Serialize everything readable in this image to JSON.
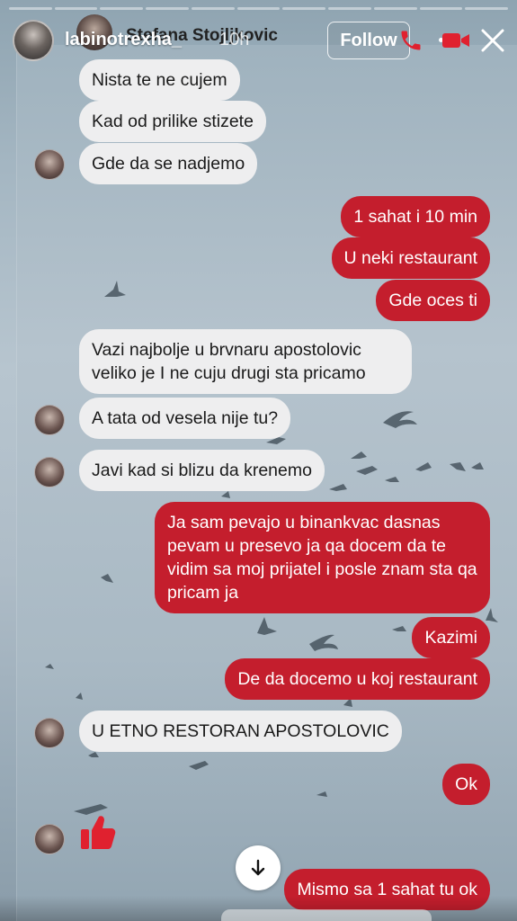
{
  "story": {
    "username": "labinotrexha_",
    "time_ago": "10h",
    "follow_label": "Follow",
    "progress_segments": 11
  },
  "chat": {
    "contact_name": "Stefana Stojljkovic",
    "messages": [
      {
        "dir": "in",
        "text": "Nista te ne cujem"
      },
      {
        "dir": "in",
        "text": "Kad od prilike stizete"
      },
      {
        "dir": "in",
        "text": "Gde da se nadjemo"
      },
      {
        "dir": "out",
        "text": "1 sahat i 10 min"
      },
      {
        "dir": "out",
        "text": "U neki restaurant"
      },
      {
        "dir": "out",
        "text": "Gde oces ti"
      },
      {
        "dir": "in",
        "text": "Vazi najbolje u brvnaru apostolovic veliko je I ne cuju drugi sta pricamo"
      },
      {
        "dir": "in",
        "text": "A tata od vesela nije tu?"
      },
      {
        "dir": "in",
        "text": "Javi kad si blizu da krenemo"
      },
      {
        "dir": "out",
        "text": "Ja sam pevajo u binankvac dasnas pevam u presevo ja qa docem da te vidim sa moj prijatel i posle znam sta qa pricam ja"
      },
      {
        "dir": "out",
        "text": "Kazimi"
      },
      {
        "dir": "out",
        "text": "De da docemo u koj restaurant"
      },
      {
        "dir": "in",
        "text": "U ETNO RESTORAN APOSTOLOVIC"
      },
      {
        "dir": "out",
        "text": "Ok"
      },
      {
        "dir": "in",
        "text": "thumbs-up"
      },
      {
        "dir": "out",
        "text": "Mismo sa 1 sahat tu ok"
      }
    ]
  },
  "colors": {
    "outgoing_bubble": "#c41e2d",
    "incoming_bubble": "#eeeeef",
    "icon_red": "#e0212f"
  },
  "icons": {
    "phone": "phone-icon",
    "video": "video-icon",
    "more": "more-icon",
    "close": "close-icon",
    "scroll": "arrow-down-icon",
    "reaction": "thumbs-up-icon"
  }
}
